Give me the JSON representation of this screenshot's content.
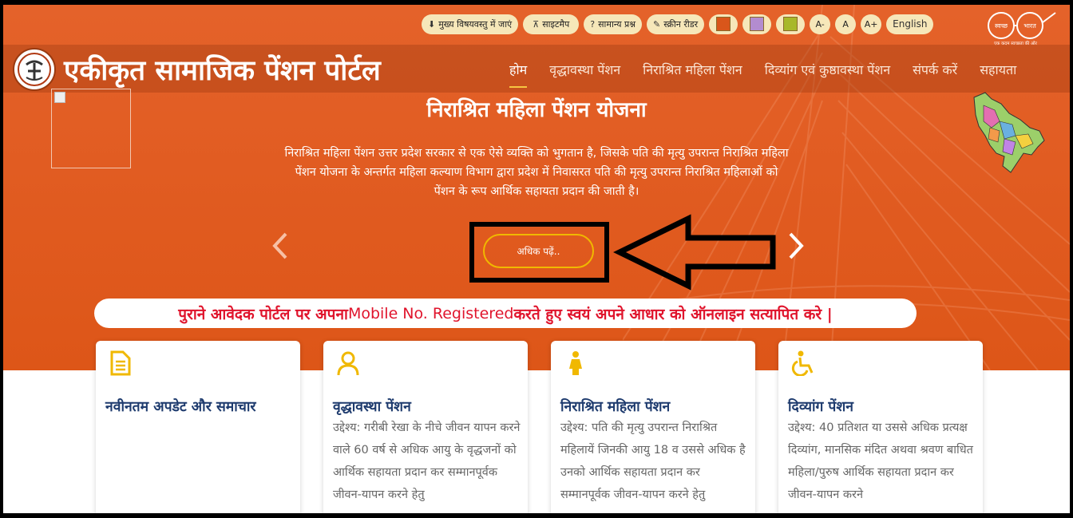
{
  "accessibility": {
    "skip_main": "मुख्य विषयवस्तु में जाएं",
    "sitemap": "साइटमैप",
    "faq": "सामान्य प्रश्न",
    "screen_reader": "स्क्रीन रीडर",
    "font_decrease": "A-",
    "font_normal": "A",
    "font_increase": "A+",
    "language": "English",
    "theme_colors": [
      "#d9561b",
      "#b38ccf",
      "#a8b82a"
    ]
  },
  "swachh_bharat": {
    "left_word": "स्वच्छ",
    "right_word": "भारत",
    "tagline": "एक कदम स्वच्छता की ओर"
  },
  "header": {
    "site_title": "एकीकृत सामाजिक पेंशन पोर्टल",
    "nav": [
      "होम",
      "वृद्धावस्था पेंशन",
      "निराश्रित महिला पेंशन",
      "दिव्यांग एवं कुष्ठावस्था पेंशन",
      "संपर्क करें",
      "सहायता"
    ],
    "active_nav": "होम"
  },
  "slide": {
    "title": "निराश्रित महिला पेंशन योजना",
    "description": "निराश्रित महिला पेंशन उत्तर प्रदेश सरकार से एक ऐसे व्यक्ति को भुगतान है, जिसके पति की मृत्यु उपरान्त निराश्रित महिला पेंशन योजना के अन्तर्गत महिला कल्याण विभाग द्वारा प्रदेश में निवासरत पति की मृत्यु उपरान्त निराश्रित महिलाओं को पेंशन के रूप आर्थिक सहायता प्रदान की जाती है।",
    "read_more": "अधिक पढ़ें.."
  },
  "notice": {
    "part1": "पुराने आवेदक पोर्टल पर अपना ",
    "part2": "Mobile No. Registered",
    "part3": " करते हुए स्वयं अपने आधार को ऑनलाइन सत्यापित करे |"
  },
  "cards": [
    {
      "icon": "document-icon",
      "title": "नवीनतम अपडेट और समाचार",
      "body": ""
    },
    {
      "icon": "user-icon",
      "title": "वृद्धावस्था पेंशन",
      "body": "उद्देश्य: गरीबी रेखा के नीचे जीवन यापन करने वाले 60 वर्ष से अधिक आयु के वृद्धजनों को आर्थिक सहायता प्रदान कर सम्मानपूर्वक जीवन-यापन करने हेतु"
    },
    {
      "icon": "woman-icon",
      "title": "निराश्रित महिला पेंशन",
      "body": "उद्देश्य: पति की मृत्यु उपरान्त निराश्रित महिलायें जिनकी आयु 18 व उससे अधिक है उनको आर्थिक सहायता प्रदान कर सम्मानपूर्वक जीवन-यापन करने हेतु"
    },
    {
      "icon": "wheelchair-icon",
      "title": "दिव्यांग पेंशन",
      "body": "उद्देश्य: 40 प्रतिशत या उससे अधिक प्रत्यक्ष दिव्यांग, मानसिक मंदित अथवा श्रवण बाधित महिला/पुरुष आर्थिक सहायता प्रदान कर जीवन-यापन करने"
    }
  ],
  "colors": {
    "hero_orange": "#e05a1f",
    "accent_yellow": "#f0b800",
    "notice_red": "#e0142c",
    "card_title": "#1e3b6e"
  }
}
